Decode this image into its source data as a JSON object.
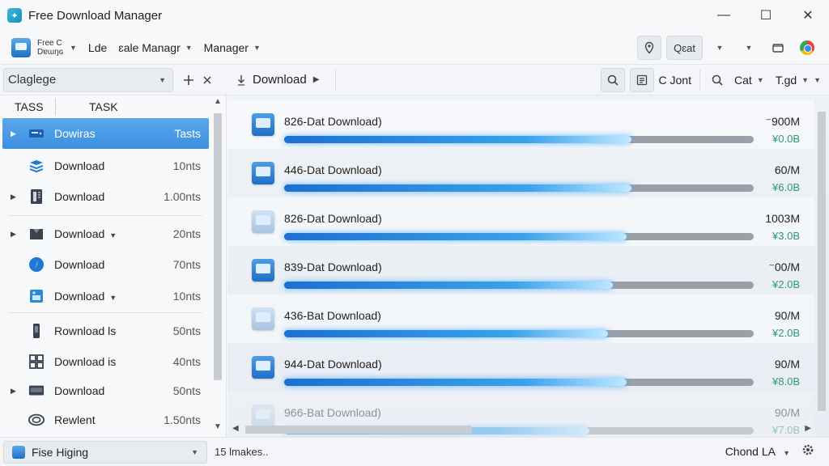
{
  "window": {
    "title": "Free Download Manager",
    "controls": {
      "minimize": "—",
      "maximize": "☐",
      "close": "✕"
    }
  },
  "toolbar": {
    "app_name_line1": "Free C",
    "app_name_line2": "Dɐɯŋɢ",
    "menus": [
      {
        "label": "Lde",
        "has_caret": false
      },
      {
        "label": "ɛale Managr",
        "has_caret": true
      },
      {
        "label": "Manager",
        "has_caret": true
      }
    ],
    "search_chip_label": "Qɛat"
  },
  "sidebar": {
    "filter_select": "Claglege",
    "column_headers": {
      "col1": "TASS",
      "col2": "TASK"
    },
    "items": [
      {
        "label": "Dowiras",
        "count": "Tasts",
        "expandable": true,
        "selected": true,
        "caret": false,
        "icon": "hdd-icon"
      },
      {
        "label": "Download",
        "count": "10nts",
        "expandable": false,
        "selected": false,
        "caret": false,
        "icon": "layers-icon"
      },
      {
        "label": "Download",
        "count": "1.00nts",
        "expandable": true,
        "selected": false,
        "caret": false,
        "icon": "document-icon"
      },
      {
        "label": "Download",
        "count": "20nts",
        "expandable": true,
        "selected": false,
        "caret": true,
        "icon": "archive-icon"
      },
      {
        "label": "Download",
        "count": "70nts",
        "expandable": false,
        "selected": false,
        "caret": false,
        "icon": "compass-icon"
      },
      {
        "label": "Download",
        "count": "10nts",
        "expandable": false,
        "selected": false,
        "caret": true,
        "icon": "image-icon"
      },
      {
        "label": "Rownload ls",
        "count": "50nts",
        "expandable": false,
        "selected": false,
        "caret": false,
        "icon": "phone-icon"
      },
      {
        "label": "Download is",
        "count": "40nts",
        "expandable": false,
        "selected": false,
        "caret": false,
        "icon": "grid-icon"
      },
      {
        "label": "Download",
        "count": "50nts",
        "expandable": true,
        "selected": false,
        "caret": false,
        "icon": "monitor-icon"
      },
      {
        "label": "Rewlent",
        "count": "1.50nts",
        "expandable": false,
        "selected": false,
        "caret": false,
        "icon": "disc-icon"
      }
    ]
  },
  "main": {
    "breadcrumb": "Download",
    "right_controls": {
      "font_label": "C Jont",
      "cat_label": "Cat",
      "tgd_label": "T.gd"
    },
    "downloads": [
      {
        "name": "826-Dat Download)",
        "size": "⁻900M",
        "speed": "¥0.0B",
        "progress": 0.74
      },
      {
        "name": "446-Dat Download)",
        "size": "60/M",
        "speed": "¥6.0B",
        "progress": 0.74
      },
      {
        "name": "826-Dat Download)",
        "size": "1003M",
        "speed": "¥3.0B",
        "progress": 0.73
      },
      {
        "name": "839-Dat Download)",
        "size": "⁻00/M",
        "speed": "¥2.0B",
        "progress": 0.7
      },
      {
        "name": "436-Bat Download)",
        "size": "90/M",
        "speed": "¥2.0B",
        "progress": 0.69
      },
      {
        "name": "944-Dat Download)",
        "size": "90/M",
        "speed": "¥8.0B",
        "progress": 0.73
      },
      {
        "name": "966-Bat Download)",
        "size": "90/M",
        "speed": "¥7.0B",
        "progress": 0.65
      }
    ]
  },
  "statusbar": {
    "select_label": "Fise Higing",
    "status_text": "15 lmakes..",
    "right_label": "Chond LA"
  }
}
